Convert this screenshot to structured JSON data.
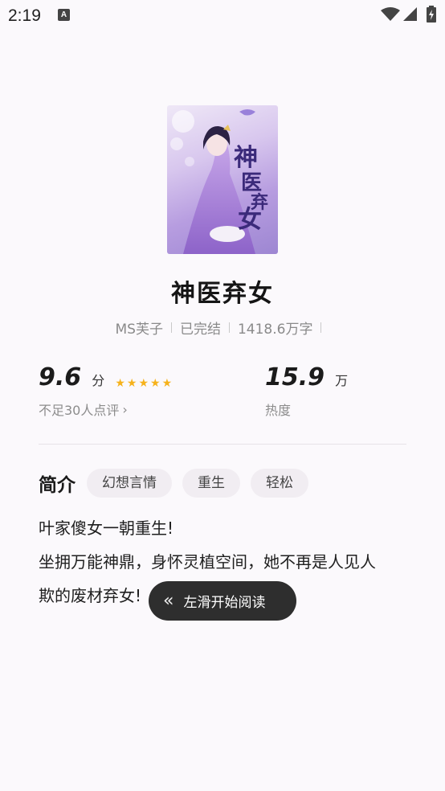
{
  "status_bar": {
    "time": "2:19",
    "notification_icon": "A",
    "icons": [
      "wifi-icon",
      "signal-icon",
      "battery-charging-icon"
    ]
  },
  "book": {
    "title": "神医弃女",
    "cover_icon": "book-cover-image",
    "author": "MS芙子",
    "status": "已完结",
    "word_count": "1418.6万字"
  },
  "rating": {
    "score": "9.6",
    "unit": "分",
    "stars": 5,
    "reviews_label": "不足30人点评"
  },
  "heat": {
    "value": "15.9",
    "unit": "万",
    "label": "热度"
  },
  "intro": {
    "title": "简介",
    "tags": [
      "幻想言情",
      "重生",
      "轻松"
    ],
    "lines": [
      "叶家傻女一朝重生!",
      "坐拥万能神鼎，身怀灵植空间，她不再是人见人",
      "欺的废材弃女!"
    ]
  },
  "toast": {
    "label": "左滑开始阅读"
  },
  "colors": {
    "background": "#fbf9fc",
    "star": "#f6b21b",
    "tag_bg": "#f1edf2",
    "toast_bg": "#2e2e2e"
  }
}
